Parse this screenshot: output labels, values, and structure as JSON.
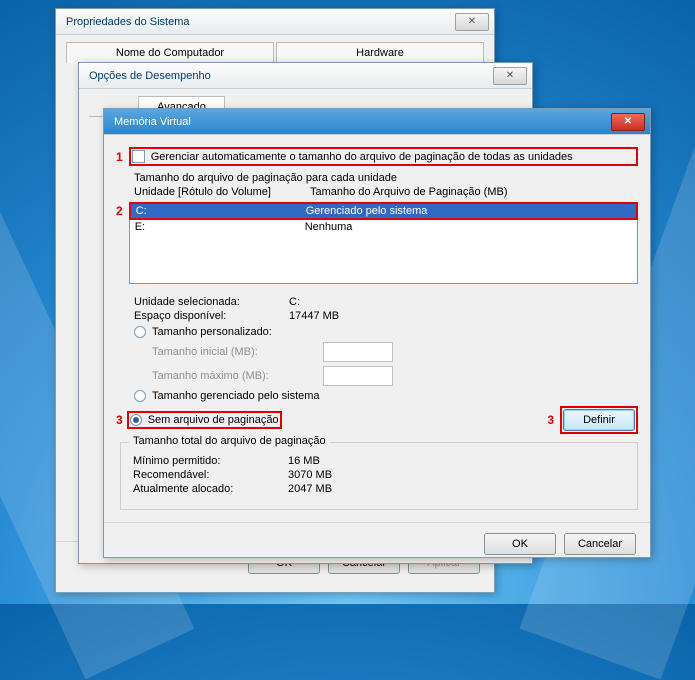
{
  "win1": {
    "title": "Propriedades do Sistema",
    "tabs": [
      "Nome do Computador",
      "Hardware"
    ],
    "buttons": {
      "ok": "OK",
      "cancel": "Cancelar",
      "apply": "Aplicar"
    }
  },
  "win2": {
    "title": "Opções de Desempenho",
    "tab_active": "Avançado"
  },
  "win3": {
    "title": "Memória Virtual",
    "auto_label": "Gerenciar automaticamente o tamanho do arquivo de paginação de todas as unidades",
    "list_caption": "Tamanho do arquivo de paginação para cada unidade",
    "col1": "Unidade [Rótulo do Volume]",
    "col2": "Tamanho do Arquivo de Paginação (MB)",
    "drives": [
      {
        "vol": "C:",
        "val": "Gerenciado pelo sistema",
        "selected": true
      },
      {
        "vol": "E:",
        "val": "Nenhuma",
        "selected": false
      }
    ],
    "selected_drive_label": "Unidade selecionada:",
    "selected_drive_value": "C:",
    "free_space_label": "Espaço disponível:",
    "free_space_value": "17447 MB",
    "custom_label": "Tamanho personalizado:",
    "initial_label": "Tamanho inicial (MB):",
    "max_label": "Tamanho máximo (MB):",
    "system_managed_label": "Tamanho gerenciado pelo sistema",
    "no_file_label": "Sem arquivo de paginação",
    "set_button": "Definir",
    "total_group": "Tamanho total do arquivo de paginação",
    "min_label": "Mínimo permitido:",
    "min_value": "16 MB",
    "rec_label": "Recomendável:",
    "rec_value": "3070 MB",
    "cur_label": "Atualmente alocado:",
    "cur_value": "2047 MB",
    "ok": "OK",
    "cancel": "Cancelar",
    "annotations": {
      "a1": "1",
      "a2": "2",
      "a3a": "3",
      "a3b": "3"
    }
  }
}
